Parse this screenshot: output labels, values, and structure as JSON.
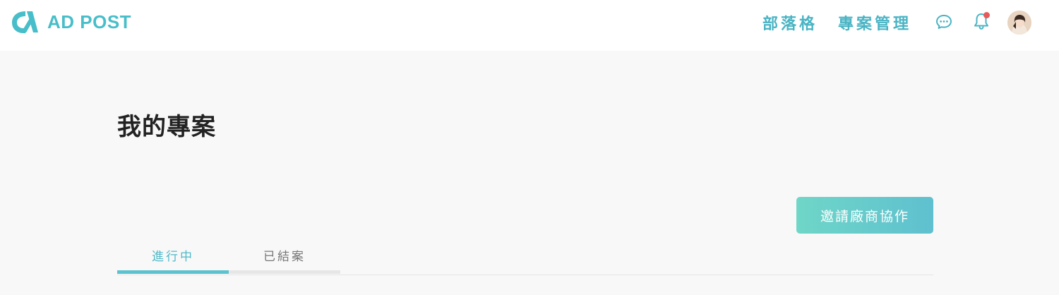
{
  "app": {
    "logo_text": "AD POST",
    "brand_color": "#47bec9"
  },
  "nav": {
    "links": [
      {
        "label": "部落格"
      },
      {
        "label": "專案管理"
      }
    ],
    "icons": {
      "chat": "chat-bubble-icon",
      "notifications": "bell-icon"
    },
    "has_unread_notification": true,
    "notification_dot_color": "#e65a5a"
  },
  "page": {
    "title": "我的專案",
    "invite_button_label": "邀請廠商協作"
  },
  "tabs": [
    {
      "label": "進行中",
      "active": true
    },
    {
      "label": "已結案",
      "active": false
    }
  ],
  "colors": {
    "accent": "#4ab4c4",
    "button_gradient_start": "#6fd6c8",
    "button_gradient_end": "#5fc0cf",
    "background": "#f8f8f8"
  }
}
